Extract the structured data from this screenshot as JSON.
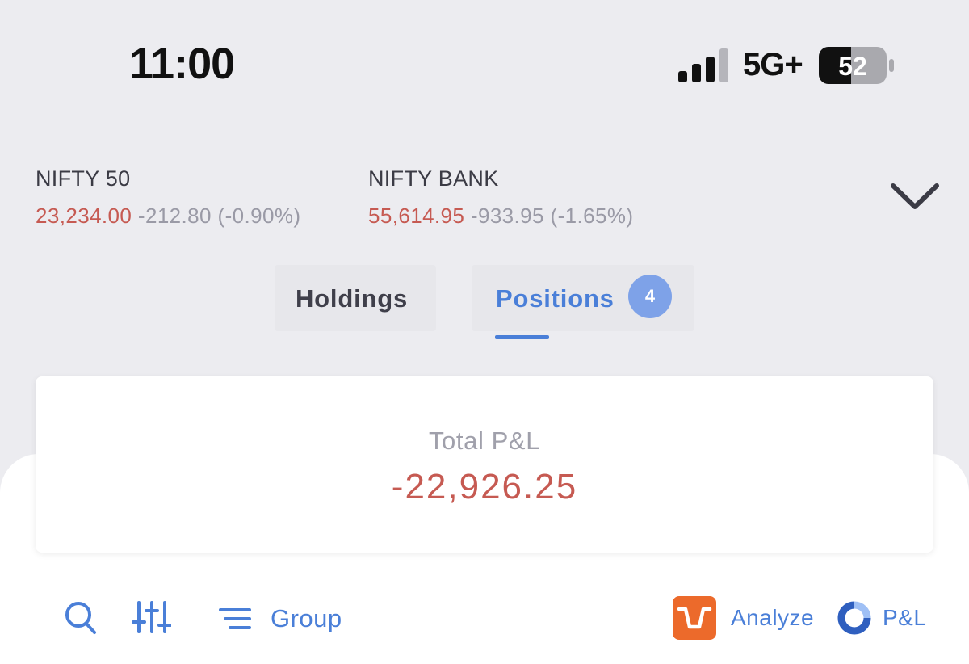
{
  "status_bar": {
    "time": "11:00",
    "network": "5G+",
    "battery": "52",
    "signal_bars_active": 3,
    "signal_bars_total": 4
  },
  "indices": [
    {
      "name": "NIFTY 50",
      "value": "23,234.00",
      "change": "-212.80 (-0.90%)"
    },
    {
      "name": "NIFTY BANK",
      "value": "55,614.95",
      "change": "-933.95 (-1.65%)"
    }
  ],
  "tabs": {
    "holdings": {
      "label": "Holdings"
    },
    "positions": {
      "label": "Positions",
      "badge": "4"
    }
  },
  "pnl": {
    "label": "Total P&L",
    "value": "-22,926.25"
  },
  "toolbar": {
    "group_label": "Group",
    "analyze_label": "Analyze",
    "pl_label": "P&L"
  },
  "colors": {
    "accent_blue": "#4a7fd8",
    "negative_red": "#c65a52",
    "muted_gray": "#9a9aa6",
    "analyze_orange": "#ec6a2b"
  }
}
